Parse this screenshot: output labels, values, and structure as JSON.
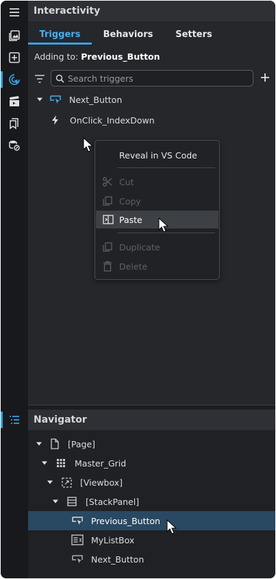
{
  "interactivity": {
    "title": "Interactivity",
    "tabs": [
      {
        "label": "Triggers",
        "active": true
      },
      {
        "label": "Behaviors",
        "active": false
      },
      {
        "label": "Setters",
        "active": false
      }
    ],
    "adding_prefix": "Adding to:",
    "adding_target": "Previous_Button",
    "search": {
      "placeholder": "Search triggers",
      "value": ""
    },
    "tree": [
      {
        "label": "Next_Button",
        "expanded": true,
        "icon": "button-cursor-icon"
      },
      {
        "label": "OnClick_IndexDown",
        "icon": "lightning-icon"
      }
    ]
  },
  "context_menu": {
    "items": [
      {
        "label": "Reveal in VS Code",
        "enabled": true
      },
      {
        "label": "Cut",
        "enabled": false,
        "icon": "scissors-icon"
      },
      {
        "label": "Copy",
        "enabled": false,
        "icon": "copy-icon"
      },
      {
        "label": "Paste",
        "enabled": true,
        "icon": "paste-icon",
        "hovered": true
      },
      {
        "label": "Duplicate",
        "enabled": false,
        "icon": "duplicate-icon"
      },
      {
        "label": "Delete",
        "enabled": false,
        "icon": "trash-icon"
      }
    ]
  },
  "navigator": {
    "title": "Navigator",
    "tree": [
      {
        "label": "[Page]",
        "icon": "page-icon"
      },
      {
        "label": "Master_Grid",
        "icon": "grid-icon"
      },
      {
        "label": "[Viewbox]",
        "icon": "viewbox-icon"
      },
      {
        "label": "[StackPanel]",
        "icon": "stackpanel-icon"
      },
      {
        "label": "Previous_Button",
        "icon": "button-cursor-icon",
        "selected": true
      },
      {
        "label": "MyListBox",
        "icon": "listbox-icon"
      },
      {
        "label": "Next_Button",
        "icon": "button-cursor-icon"
      }
    ]
  },
  "colors": {
    "accent": "#3aa0e8",
    "selection": "#294862",
    "panel": "#25272b"
  }
}
